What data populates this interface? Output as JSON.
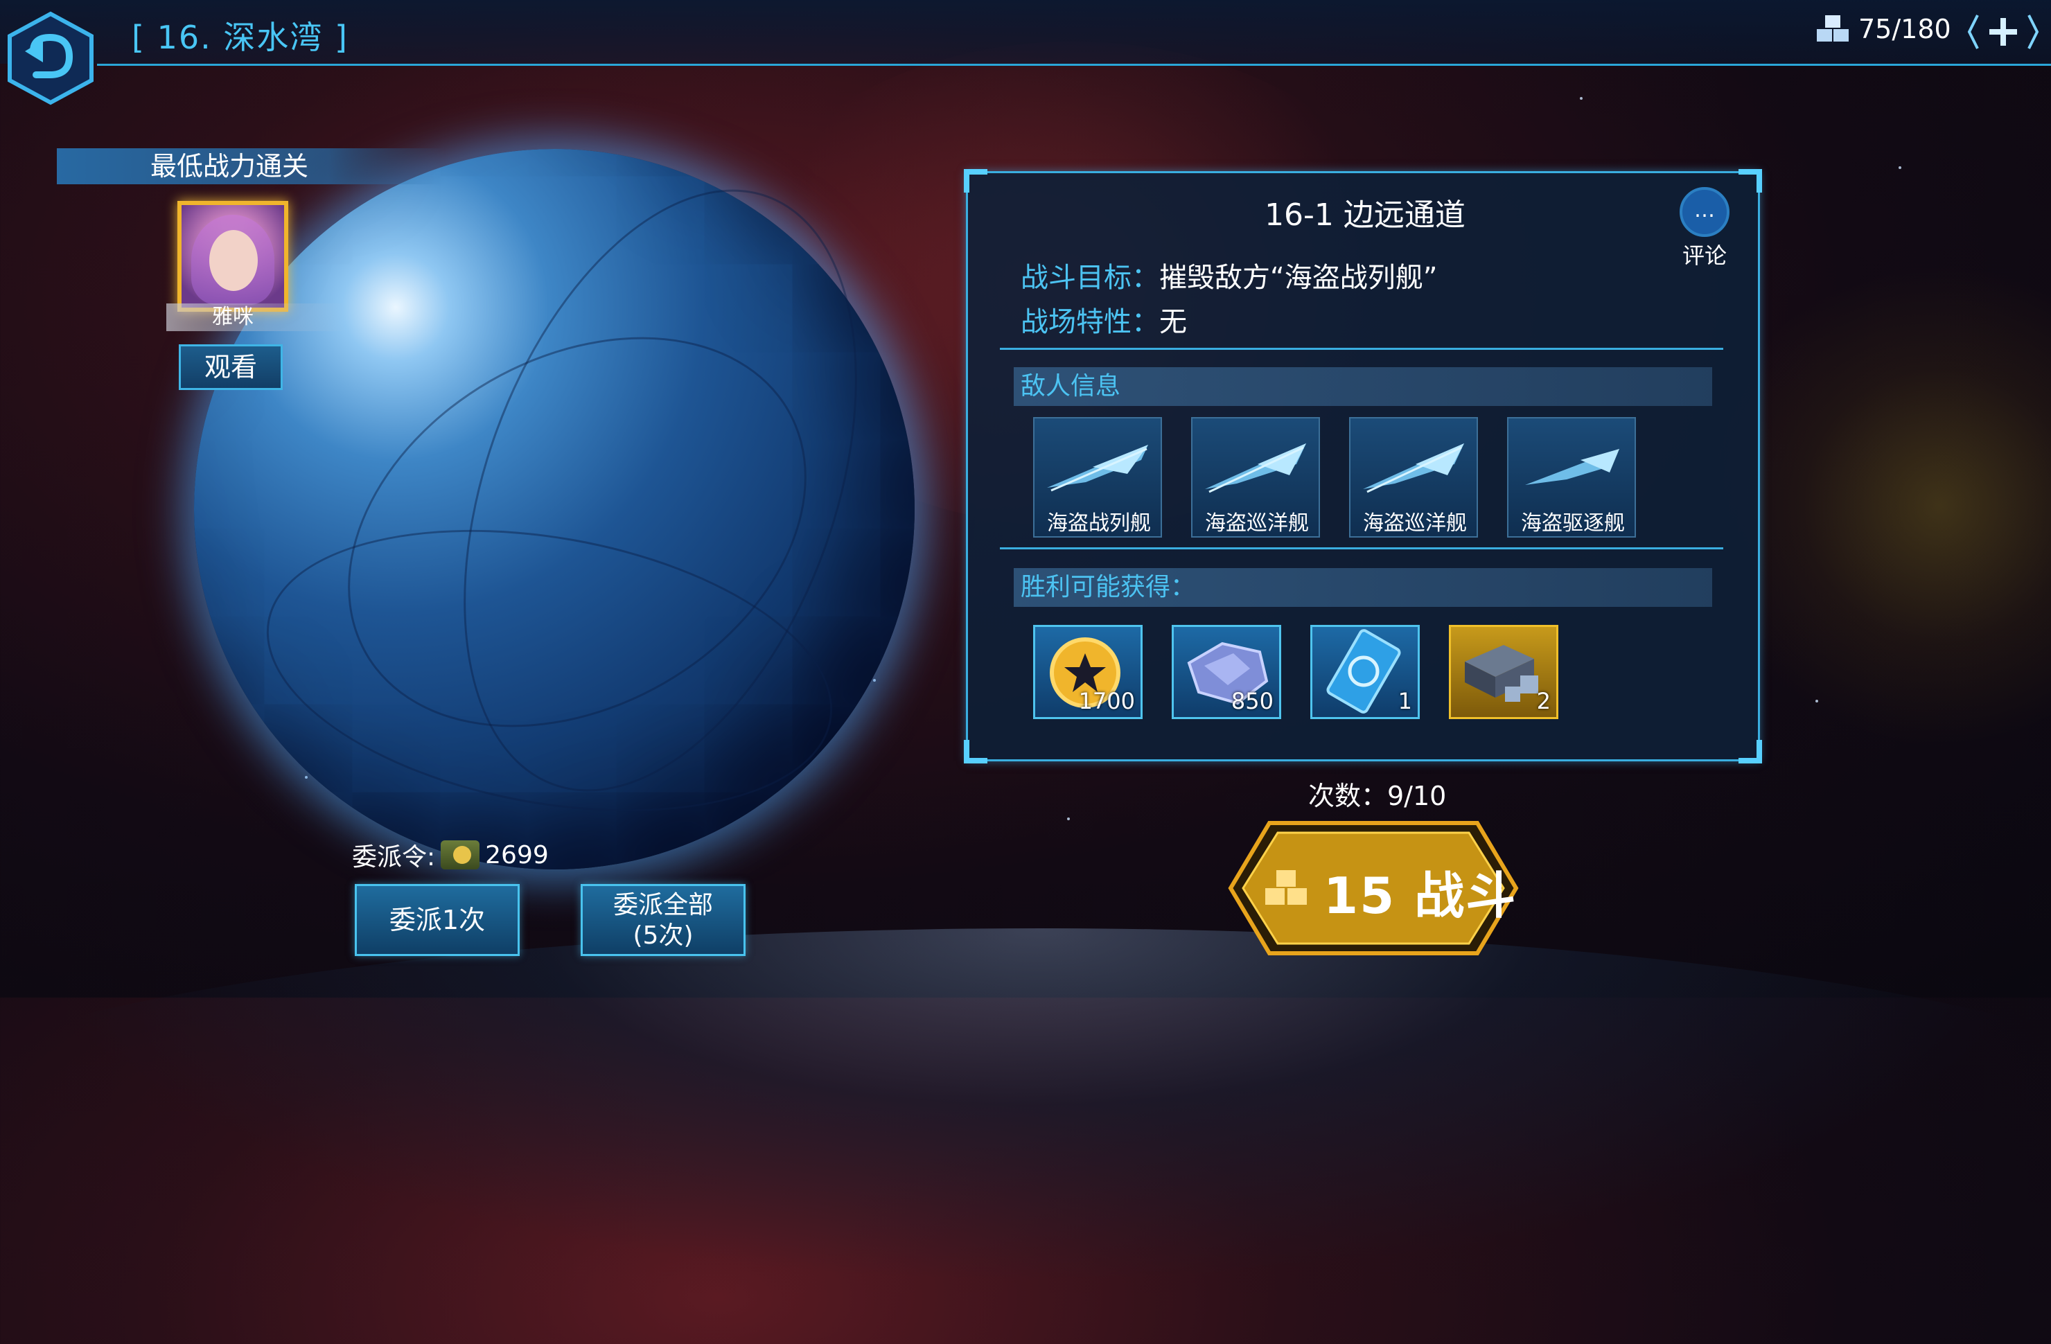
{
  "header": {
    "stage_title": "[ 16. 深水湾 ]",
    "energy": "75/180",
    "icons": {
      "back": "back-arrow-icon",
      "energy": "cube-stack-icon",
      "add": "plus-icon"
    }
  },
  "lowest_power": {
    "banner": "最低战力通关",
    "player_name": "雅咪",
    "watch_label": "观看"
  },
  "dispatch": {
    "token_label": "委派令:",
    "token_count": "2699",
    "dispatch_once": "委派1次",
    "dispatch_all_line1": "委派全部",
    "dispatch_all_line2": "(5次)"
  },
  "stage": {
    "name": "16-1 边远通道",
    "comment_label": "评论",
    "objective_label": "战斗目标：",
    "objective_value": "摧毁敌方“海盗战列舰”",
    "trait_label": "战场特性：",
    "trait_value": "无",
    "enemy_header": "敌人信息",
    "enemies": [
      {
        "name": "海盗战列舰"
      },
      {
        "name": "海盗巡洋舰"
      },
      {
        "name": "海盗巡洋舰"
      },
      {
        "name": "海盗驱逐舰"
      }
    ],
    "reward_header": "胜利可能获得：",
    "rewards": [
      {
        "icon": "gold-coin-icon",
        "qty": "1700"
      },
      {
        "icon": "ore-icon",
        "qty": "850"
      },
      {
        "icon": "blueprint-card-icon",
        "qty": "1"
      },
      {
        "icon": "component-crate-icon",
        "qty": "2"
      }
    ]
  },
  "battle": {
    "attempts": "次数：9/10",
    "label": "15 战斗"
  }
}
